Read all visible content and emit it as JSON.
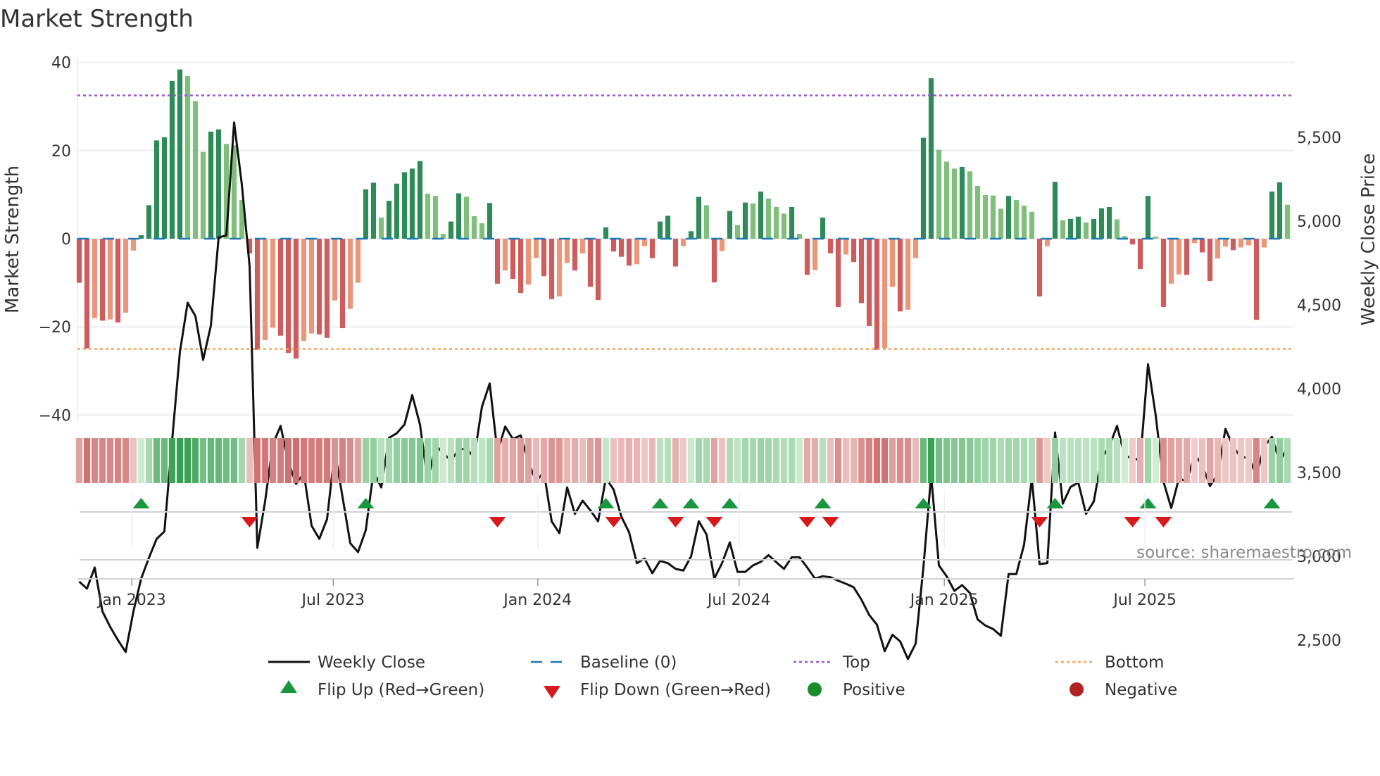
{
  "chart_data": {
    "type": "bar",
    "title": "Market Strength",
    "ylabel": "Market Strength",
    "y2label": "Weekly Close Price",
    "ylim": [
      -40,
      40
    ],
    "y2lim": [
      2250,
      5750
    ],
    "yticks": [
      40,
      20,
      0,
      -20,
      -40
    ],
    "ytick_labels": [
      "40",
      "20",
      "0",
      "−20",
      "−40"
    ],
    "y2ticks": [
      5500,
      5000,
      4500,
      4000,
      3500,
      3000,
      2500
    ],
    "y2tick_labels": [
      "5,500",
      "5,000",
      "4,500",
      "4,000",
      "3,500",
      "3,000",
      "2,500"
    ],
    "x_unit": "week index",
    "xticks": [
      6.8,
      32.8,
      59.2,
      85.2,
      111.7,
      137.6
    ],
    "xtick_labels": [
      "Jan 2023",
      "Jul 2023",
      "Jan 2024",
      "Jul 2024",
      "Jan 2025",
      "Jul 2025"
    ],
    "top_level": 32.5,
    "bottom_level": -25,
    "baseline": 0,
    "strength": [
      -10,
      -24.9,
      -18,
      -18.6,
      -18.3,
      -19,
      -16.8,
      -2.7,
      0.8,
      7.6,
      22.3,
      23,
      35.8,
      38.4,
      36.9,
      31.2,
      19.7,
      24.3,
      24.8,
      21.5,
      21.2,
      8.8,
      -3.3,
      -25.2,
      -23,
      -20.2,
      -22,
      -25.9,
      -27.2,
      -23.2,
      -21.5,
      -21.7,
      -22.5,
      -14,
      -20.3,
      -15.9,
      -10,
      11.2,
      12.7,
      4.8,
      8.6,
      12.5,
      15.1,
      15.9,
      17.6,
      10.2,
      9.7,
      1.1,
      3.9,
      10.3,
      9.5,
      5.1,
      3.5,
      8.1,
      -10.2,
      -7.2,
      -9.1,
      -12.3,
      -10.4,
      -4.4,
      -8.5,
      -13.7,
      -13.1,
      -5.5,
      -7.2,
      -3.3,
      -10.9,
      -13.9,
      2.6,
      -2.9,
      -4.1,
      -6.1,
      -5.8,
      -1.7,
      -4.4,
      3.9,
      5.2,
      -6.3,
      -1.7,
      1.7,
      9.5,
      7.6,
      -9.9,
      -2.8,
      6.3,
      3.1,
      8.2,
      8,
      10.7,
      9.1,
      7.2,
      5.7,
      7.2,
      1.1,
      -8.2,
      -7.1,
      4.8,
      -3.3,
      -15.5,
      -3.6,
      -5.3,
      -14.6,
      -19.8,
      -25.2,
      -24.8,
      -10.9,
      -16.5,
      -16.1,
      -4.4,
      22.9,
      36.4,
      20.2,
      17.5,
      15.9,
      16.3,
      15.3,
      12,
      9.9,
      9.8,
      6.8,
      9.7,
      8.8,
      7.5,
      6.1,
      -13.1,
      -1.7,
      12.9,
      4.2,
      4.5,
      5,
      3.7,
      4.5,
      6.9,
      7.2,
      4.4,
      0.6,
      -1.3,
      -6.9,
      9.7,
      0.5,
      -15.5,
      -10.2,
      -8.1,
      -8.2,
      -1,
      -3.1,
      -9.6,
      -4.5,
      -1.8,
      -2.6,
      -2,
      -1.5,
      -18.4,
      -2,
      10.7,
      12.8,
      7.7
    ],
    "weekly_close": [
      2849,
      2807,
      2933,
      2671,
      2579,
      2500,
      2429,
      2671,
      2867,
      2991,
      3104,
      3148,
      3694,
      4219,
      4513,
      4434,
      4172,
      4377,
      4902,
      4915,
      5589,
      5217,
      4731,
      3051,
      3327,
      3668,
      3778,
      3563,
      3432,
      3497,
      3183,
      3104,
      3222,
      3629,
      3354,
      3078,
      3025,
      3156,
      3505,
      3411,
      3707,
      3734,
      3786,
      3962,
      3786,
      3445,
      3663,
      3616,
      3571,
      3637,
      3643,
      3590,
      3892,
      4031,
      3621,
      3774,
      3700,
      3721,
      3563,
      3445,
      3505,
      3209,
      3138,
      3411,
      3253,
      3332,
      3274,
      3209,
      3466,
      3398,
      3236,
      3143,
      2959,
      2986,
      2899,
      2973,
      2959,
      2925,
      2915,
      2999,
      3209,
      3130,
      2867,
      2959,
      3083,
      2907,
      2907,
      2946,
      2967,
      3007,
      2965,
      2925,
      2994,
      2994,
      2933,
      2867,
      2881,
      2875,
      2854,
      2836,
      2815,
      2741,
      2650,
      2592,
      2434,
      2532,
      2492,
      2387,
      2479,
      2933,
      3484,
      2946,
      2881,
      2794,
      2828,
      2781,
      2623,
      2587,
      2566,
      2526,
      2894,
      2894,
      3070,
      3466,
      2954,
      2959,
      3739,
      3314,
      3414,
      3440,
      3253,
      3327,
      3584,
      3655,
      3778,
      3595,
      3590,
      3569,
      4146,
      3839,
      3445,
      3288,
      3466,
      3445,
      3608,
      3545,
      3419,
      3490,
      3760,
      3655,
      3590,
      3590,
      3484,
      3655,
      3713,
      3563,
      3650
    ],
    "flip_up_weeks": [
      8,
      37,
      68,
      75,
      79,
      84,
      96,
      109,
      126,
      138,
      154
    ],
    "flip_down_weeks": [
      22,
      54,
      69,
      77,
      82,
      94,
      97,
      124,
      136,
      140
    ],
    "legend_position": "bottom",
    "grid": true
  },
  "legend": {
    "weekly_close": "Weekly Close",
    "baseline": "Baseline (0)",
    "top": "Top",
    "bottom": "Bottom",
    "flip_up": "Flip Up (Red→Green)",
    "flip_down": "Flip Down (Green→Red)",
    "positive": "Positive",
    "negative": "Negative"
  },
  "source": "source: sharemaestro.com",
  "colors": {
    "green_dark": "#2e8b57",
    "green_light": "#7fbf7b",
    "red_dark": "#cd5c5c",
    "red_light": "#e9967a",
    "top": "#9b59d0",
    "bottom": "#f4a460",
    "baseline": "#1f77b4",
    "flip_up": "#1a9641",
    "flip_down": "#d7191c",
    "positive": "#1a8c2a",
    "negative": "#b22222"
  }
}
